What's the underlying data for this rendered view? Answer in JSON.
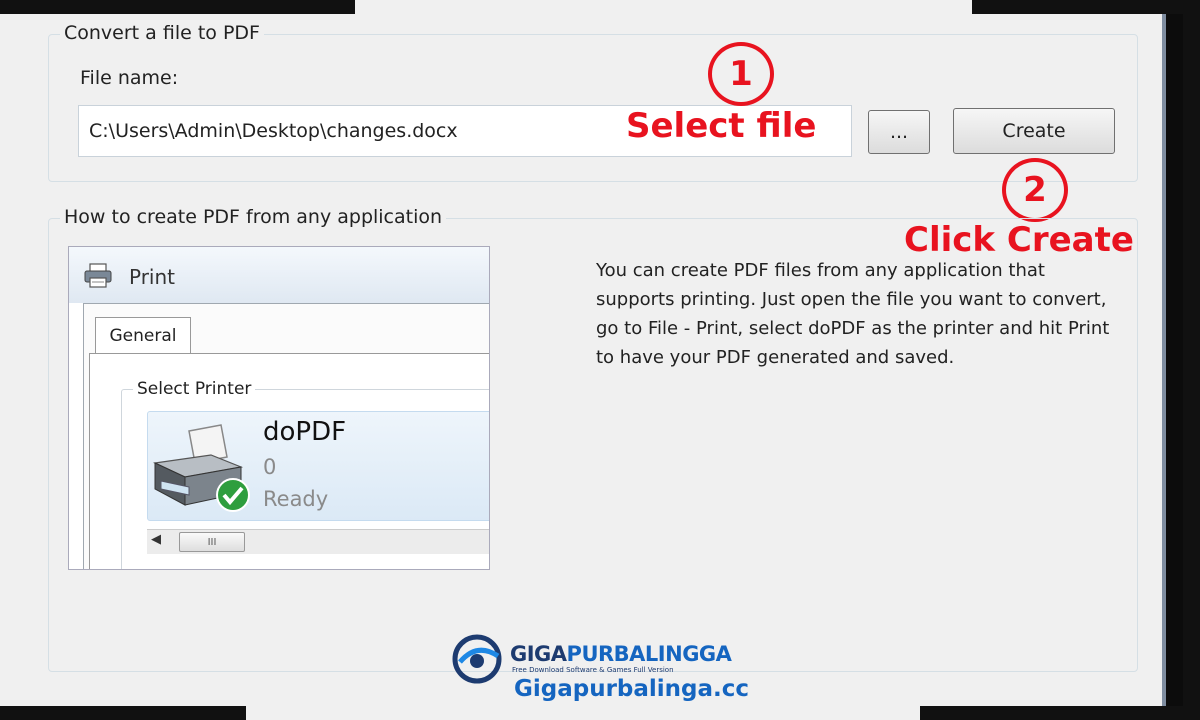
{
  "convert_group": {
    "title": "Convert a file to PDF",
    "file_label": "File name:",
    "file_value": "C:\\Users\\Admin\\Desktop\\changes.docx",
    "browse_label": "...",
    "create_label": "Create"
  },
  "annotations": {
    "step1_number": "1",
    "step1_text": "Select file",
    "step2_number": "2",
    "step2_text": "Click Create"
  },
  "howto_group": {
    "title": "How to create PDF from any application",
    "description": "You can create PDF files from any application that supports printing. Just open the file you want to convert, go to File - Print, select doPDF as the printer and hit Print to have your PDF generated and saved."
  },
  "print_preview": {
    "title": "Print",
    "tab": "General",
    "section": "Select Printer",
    "printer_name": "doPDF",
    "printer_jobs": "0",
    "printer_status": "Ready",
    "scroll_thumb": "III"
  },
  "watermark": {
    "brand_a": "GIGA",
    "brand_b": "PURBALINGGA",
    "tagline": "Free Download Software & Games Full Version",
    "url": "Gigapurbalinga.cc"
  },
  "colors": {
    "annotation": "#e8131f",
    "brand_blue": "#1565c0",
    "window_bg": "#f0f0f0"
  }
}
